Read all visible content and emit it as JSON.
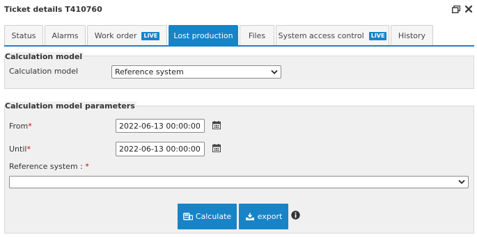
{
  "window": {
    "title": "Ticket details T410760"
  },
  "tabs": [
    {
      "label": "Status",
      "live": ""
    },
    {
      "label": "Alarms",
      "live": ""
    },
    {
      "label": "Work order",
      "live": "LIVE"
    },
    {
      "label": "Lost production",
      "live": ""
    },
    {
      "label": "Files",
      "live": ""
    },
    {
      "label": "System access control",
      "live": "LIVE"
    },
    {
      "label": "History",
      "live": ""
    }
  ],
  "calc_model": {
    "section_title": "Calculation model",
    "field_label": "Calculation model",
    "selected": "Reference system"
  },
  "params": {
    "section_title": "Calculation model parameters",
    "from_label": "From",
    "from_value": "2022-06-13 00:00:00",
    "until_label": "Until",
    "until_value": "2022-06-13 00:00:00",
    "ref_label": "Reference system :",
    "required_mark": "*",
    "ref_selected": ""
  },
  "actions": {
    "calculate_label": "Calculate",
    "export_label": "export"
  },
  "colors": {
    "accent": "#1784c7",
    "panel_bg": "#f0f0f0",
    "required": "#cc0000"
  }
}
